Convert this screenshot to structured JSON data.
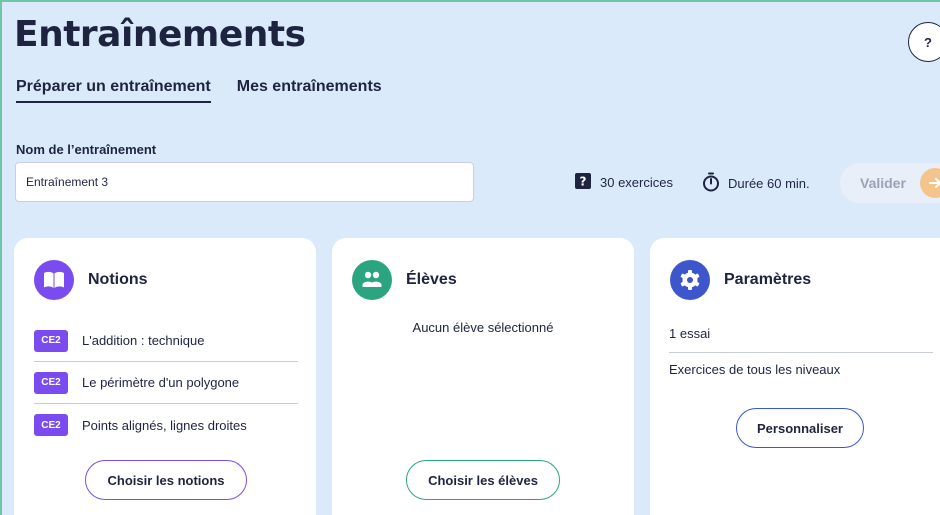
{
  "header": {
    "title": "Entraînements",
    "help_label": "?"
  },
  "tabs": [
    {
      "label": "Préparer un entraînement",
      "active": true
    },
    {
      "label": "Mes entraînements",
      "active": false
    }
  ],
  "form": {
    "name_label": "Nom de l’entraînement",
    "name_value": "Entraînement 3"
  },
  "stats": {
    "exercises": "30 exercices",
    "duration": "Durée 60 min."
  },
  "actions": {
    "validate_label": "Valider"
  },
  "cards": {
    "notions": {
      "title": "Notions",
      "items": [
        {
          "badge": "CE2",
          "label": "L'addition : technique"
        },
        {
          "badge": "CE2",
          "label": "Le périmètre d'un polygone"
        },
        {
          "badge": "CE2",
          "label": "Points alignés, lignes droites"
        }
      ],
      "button_label": "Choisir les notions"
    },
    "eleves": {
      "title": "Élèves",
      "empty_message": "Aucun élève sélectionné",
      "button_label": "Choisir les élèves"
    },
    "parametres": {
      "title": "Paramètres",
      "rows": [
        "1 essai",
        "Exercices de tous les niveaux"
      ],
      "button_label": "Personnaliser"
    }
  },
  "colors": {
    "background": "#dbeafb",
    "notions_accent": "#7a4cf0",
    "eleves_accent": "#2aa57f",
    "params_accent": "#3d56cc",
    "validate_arrow": "#f3c58d"
  },
  "icons": [
    "help-icon",
    "exercises-icon",
    "timer-icon",
    "arrow-right-icon",
    "book-icon",
    "students-icon",
    "gear-icon"
  ]
}
